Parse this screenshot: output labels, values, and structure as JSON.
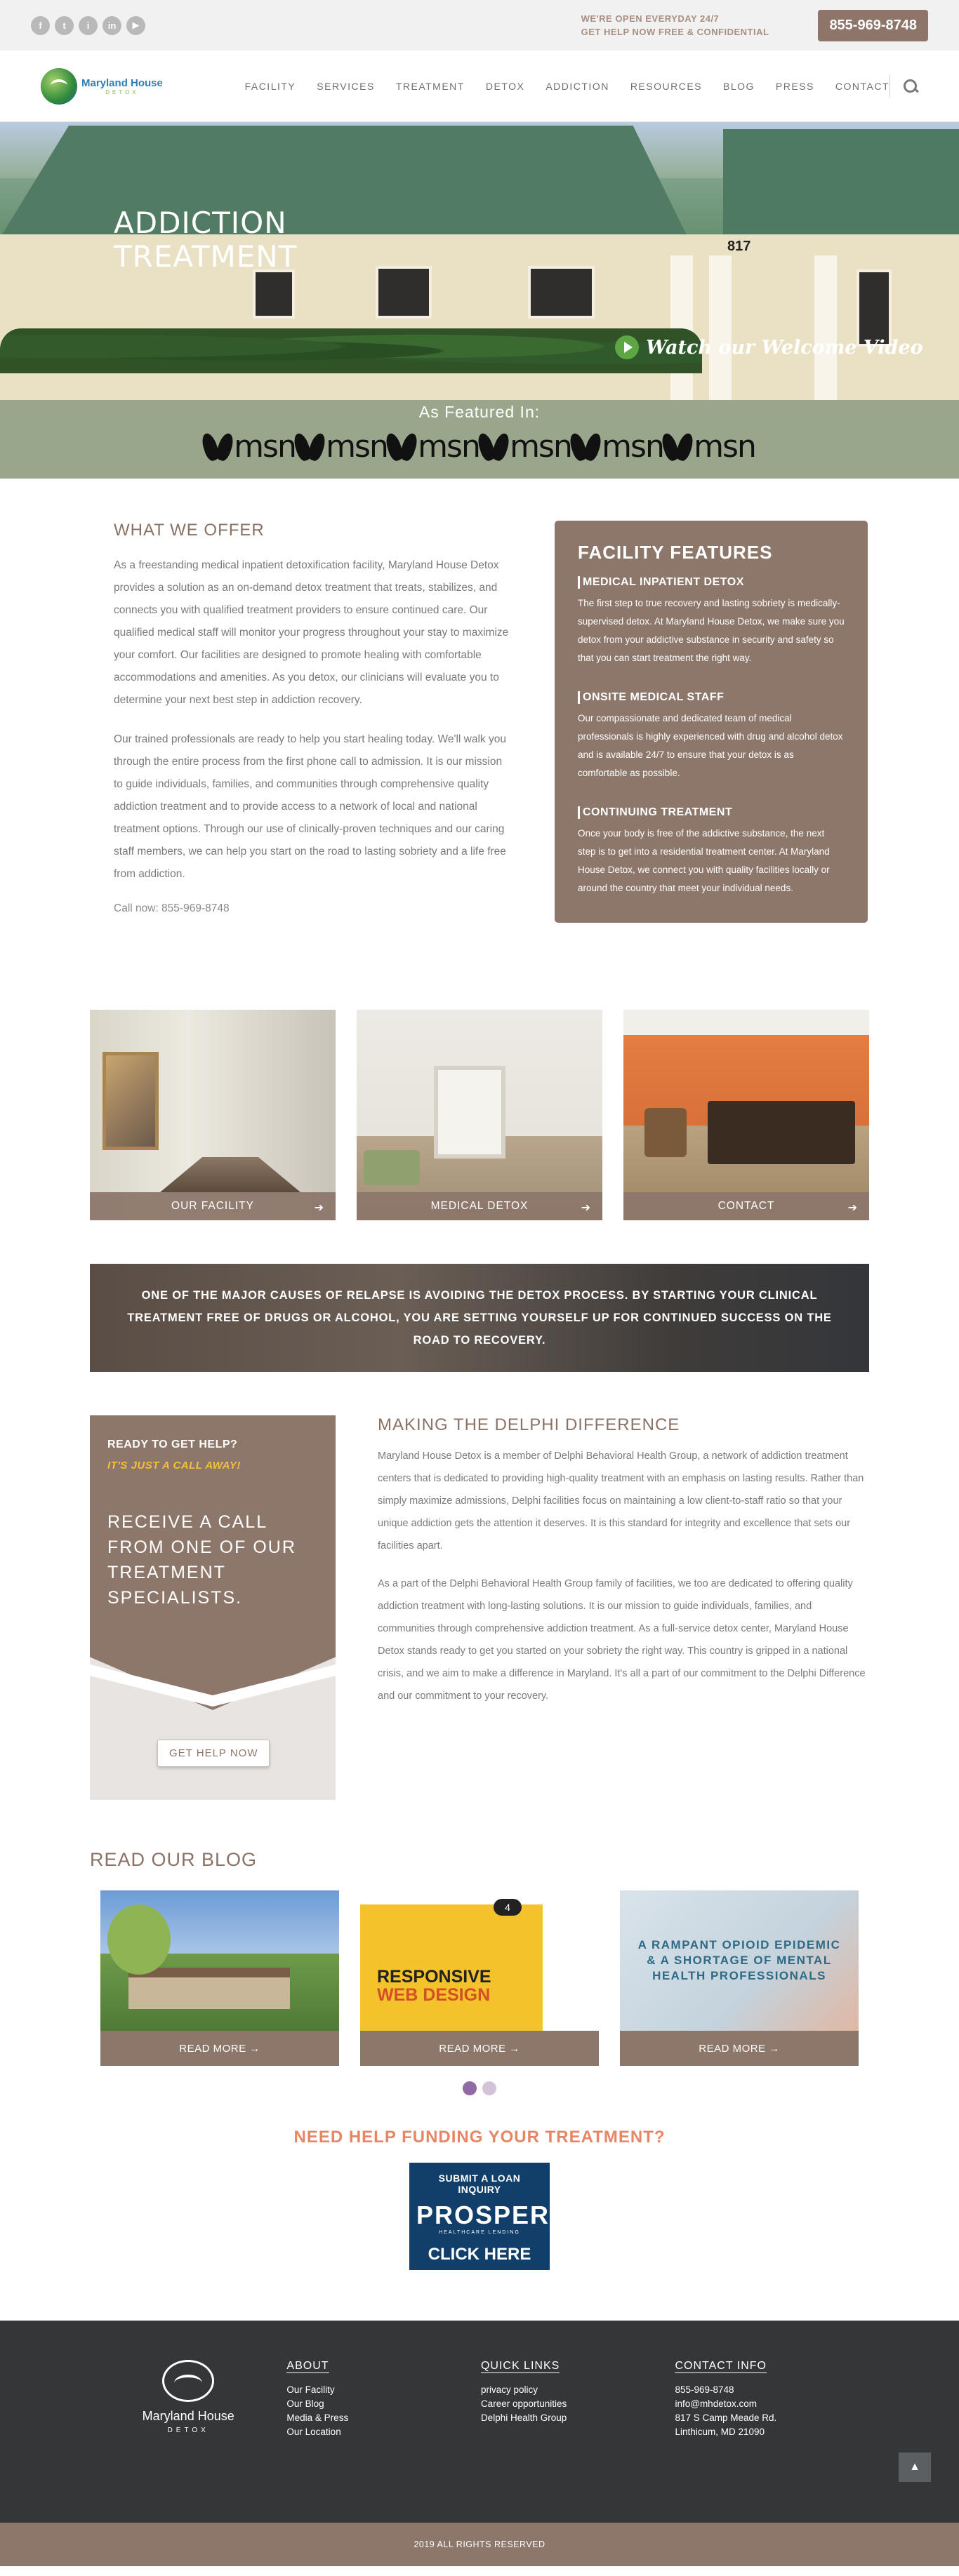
{
  "topbar": {
    "social_icons": [
      "facebook-icon",
      "twitter-icon",
      "instagram-icon",
      "linkedin-icon",
      "youtube-icon"
    ],
    "social_glyphs": [
      "f",
      "t",
      "i",
      "in",
      "▶"
    ],
    "open_line1": "WE'RE OPEN EVERYDAY 24/7",
    "open_line2": "GET HELP NOW FREE & CONFIDENTIAL",
    "phone": "855-969-8748"
  },
  "nav": {
    "logo_name": "Maryland House",
    "logo_sub": "DETOX",
    "items": [
      "FACILITY",
      "SERVICES",
      "TREATMENT",
      "DETOX",
      "ADDICTION",
      "RESOURCES",
      "BLOG",
      "PRESS",
      "CONTACT"
    ]
  },
  "hero": {
    "title_line1": "ADDICTION",
    "title_line2": "TREATMENT",
    "house_number": "817",
    "video_link": "Watch our Welcome Video"
  },
  "featured": {
    "title": "As Featured In:",
    "logos": [
      "msn",
      "msn",
      "msn",
      "msn",
      "msn",
      "msn"
    ]
  },
  "offer": {
    "title": "WHAT WE OFFER",
    "para1": "As a freestanding medical inpatient detoxification facility, Maryland House Detox provides a solution as an on-demand detox treatment that treats, stabilizes, and connects you with qualified treatment providers to ensure continued care. Our qualified medical staff will monitor your progress throughout your stay to maximize your comfort. Our facilities are designed to promote healing with comfortable accommodations and amenities. As you detox, our clinicians will evaluate you to determine your next best step in addiction recovery.",
    "para2": "Our trained professionals are ready to help you start healing today. We'll walk you through the entire process from the first phone call to admission. It is our mission to guide individuals, families, and communities through comprehensive quality addiction treatment and to provide access to a network of local and national treatment options. Through our use of clinically-proven techniques and our caring staff members, we can help you start on the road to lasting sobriety and a life free from addiction.",
    "call_now": "Call now: 855-969-8748"
  },
  "features": {
    "title": "FACILITY FEATURES",
    "items": [
      {
        "head": "MEDICAL INPATIENT DETOX",
        "body": "The first step to true recovery and lasting sobriety is medically-supervised detox. At Maryland House Detox, we make sure you detox from your addictive substance in security and safety so that you can start treatment the right way."
      },
      {
        "head": "ONSITE MEDICAL STAFF",
        "body": "Our compassionate and dedicated team of medical professionals is highly experienced with drug and alcohol detox and is available 24/7 to ensure that your detox is as comfortable as possible."
      },
      {
        "head": "CONTINUING TREATMENT",
        "body": "Once your body is free of the addictive substance, the next step is to get into a residential treatment center. At Maryland House Detox, we connect you with quality facilities locally or around the country that meet your individual needs."
      }
    ]
  },
  "cards": [
    {
      "label": "OUR FACILITY"
    },
    {
      "label": "MEDICAL DETOX"
    },
    {
      "label": "CONTACT"
    }
  ],
  "banner": {
    "text": "ONE OF THE MAJOR CAUSES OF RELAPSE IS AVOIDING THE DETOX PROCESS. BY STARTING YOUR CLINICAL TREATMENT FREE OF DRUGS OR ALCOHOL, YOU ARE SETTING YOURSELF UP FOR CONTINUED SUCCESS ON THE ROAD TO RECOVERY."
  },
  "help_box": {
    "question": "READY TO GET HELP?",
    "subline": "IT'S JUST A CALL AWAY!",
    "call_text": "RECEIVE A CALL FROM ONE OF OUR TREATMENT SPECIALISTS.",
    "button": "GET HELP NOW"
  },
  "delphi": {
    "title": "MAKING THE DELPHI DIFFERENCE",
    "para1": "Maryland House Detox is a member of Delphi Behavioral Health Group, a network of addiction treatment centers that is dedicated to providing high-quality treatment with an emphasis on lasting results. Rather than simply maximize admissions, Delphi facilities focus on maintaining a low client-to-staff ratio so that your unique addiction gets the attention it deserves. It is this standard for integrity and excellence that sets our facilities apart.",
    "para2": "As a part of the Delphi Behavioral Health Group family of facilities, we too are dedicated to offering quality addiction treatment with long-lasting solutions. It is our mission to guide individuals, families, and communities through comprehensive addiction treatment. As a full-service detox center, Maryland House Detox stands ready to get you started on your sobriety the right way. This country is gripped in a national crisis, and we aim to make a difference in Maryland. It's all a part of our commitment to the Delphi Difference and our commitment to your recovery."
  },
  "blog": {
    "title": "READ OUR BLOG",
    "read_more": "READ MORE →",
    "post2_line1": "RESPONSIVE",
    "post2_line2": "WEB DESIGN",
    "post2_badge": "4",
    "post3_text": "A RAMPANT OPIOID EPIDEMIC & A SHORTAGE OF MENTAL HEALTH PROFESSIONALS"
  },
  "funding": {
    "title": "NEED HELP FUNDING YOUR TREATMENT?",
    "ad_top": "SUBMIT A LOAN INQUIRY",
    "ad_logo": "PROSPER",
    "ad_sub": "HEALTHCARE LENDING",
    "ad_cta": "CLICK HERE"
  },
  "footer": {
    "logo_name": "Maryland House",
    "logo_sub": "DETOX",
    "about_title": "ABOUT",
    "about_links": [
      "Our Facility",
      "Our Blog",
      "Media & Press",
      "Our Location"
    ],
    "quick_title": "QUICK LINKS",
    "quick_links": [
      "privacy policy",
      "Career opportunities",
      "Delphi Health Group"
    ],
    "contact_title": "CONTACT INFO",
    "contact_lines": [
      "855-969-8748",
      "info@mhdetox.com",
      "817 S Camp Meade Rd.",
      "Linthicum, MD 21090"
    ],
    "scroll_top": "▲",
    "copyright": "2019 ALL RIGHTS RESERVED"
  },
  "colors": {
    "brand_brown": "#8d776b",
    "title_brown": "#8a7266",
    "accent_orange": "#e78665",
    "accent_yellow": "#f6bf36",
    "footer_dark": "#343638"
  }
}
